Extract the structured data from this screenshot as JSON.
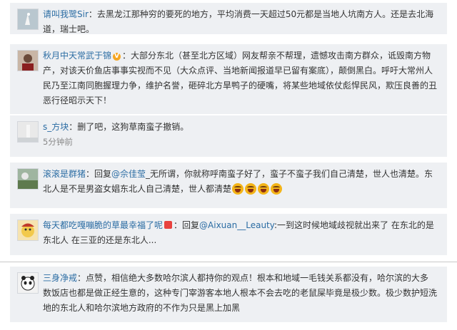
{
  "comments": [
    {
      "name": "请叫我鹭Sir",
      "sep": "：",
      "text": "去黑龙江那种穷的要死的地方，平均消费一天超过50元都是当地人坑南方人。还是去北海道，瑞士吧。"
    },
    {
      "name": "秋月中天常武于锦",
      "text": "：大部分东北（甚至北方区域）网友帮亲不帮理，遗憾攻击南方群众，诋毁南方物产，对该天价鱼店事事实视而不见（大众点评、当地新闻报道早已留有案底），颠倒黑白。呼吁大常州人民乃至江南同胞握理力争，维护名誉，砸碎北方旱鸭子的硬嘴，将某些地域依仗彪悍民风，欺压良善的丑恶行径昭示天下！"
    },
    {
      "name": "s_方块",
      "text": "：删了吧，这狗草南蛮子撤销。",
      "time": "5分钟前"
    },
    {
      "name": "滚滚是群猪",
      "text_a": "：回复",
      "mention": "@佘佳莹",
      "text_b": "_无所谓，你就称呼南蛮子好了，蛮子不蛮子我们自己清楚，世人也清楚。东北人是不是男盗女娼东北人自己清楚，世人都清楚"
    },
    {
      "name": "每天都吃嘎嘣脆的草最幸福了呢",
      "text_a": "：回复",
      "mention": "@Aixuan__Leauty",
      "text_b": ":一到这时候地域歧视就出来了 在东北的是东北人 在三亚的还是东北人..."
    },
    {
      "name": "三身净戒",
      "text": "：点赞，相信绝大多数哈尔滨人都持你的观点！根本和地域一毛钱关系都没有，哈尔滨的大多数饭店也都是做正经生意的，这种专门宰游客本地人根本不会去吃的老鼠屎毕竟是极少数。极少数护短洗地的东北人和哈尔滨地方政府的不作为只是黑上加黑"
    }
  ],
  "icons": [
    "v-badge-icon",
    "gift-icon",
    "laugh-emoji-icon"
  ],
  "colors": {
    "name": "#2b6ca3",
    "card_bg": "#eef0f3",
    "meta": "#888888"
  }
}
